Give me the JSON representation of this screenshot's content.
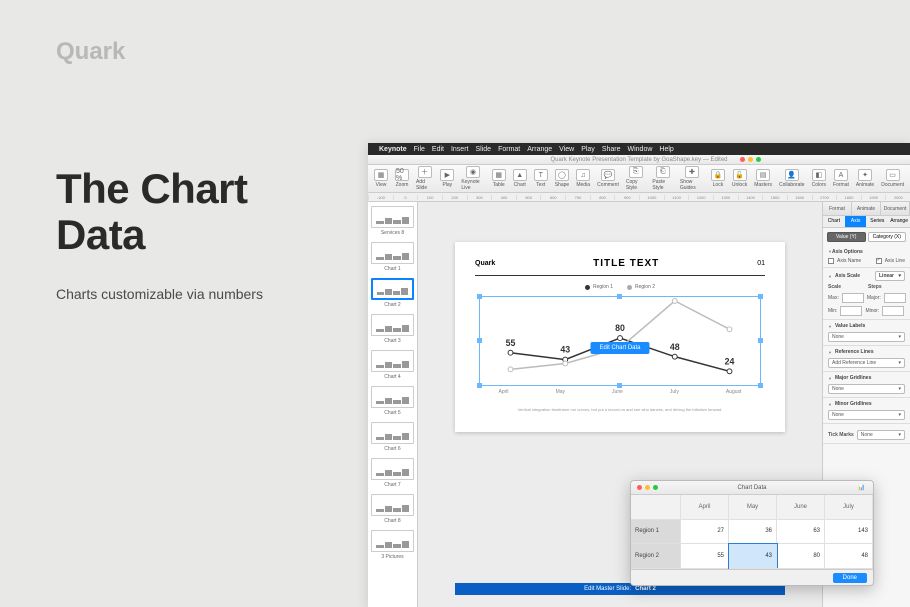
{
  "marketing": {
    "brand": "Quark",
    "headline": "The Chart Data",
    "subtext": "Charts customizable via numbers"
  },
  "menubar": [
    "Keynote",
    "File",
    "Edit",
    "Insert",
    "Slide",
    "Format",
    "Arrange",
    "View",
    "Play",
    "Share",
    "Window",
    "Help"
  ],
  "window_title": "Quark Keynote Presentation Template by GoaShape.key — Edited",
  "toolbar": [
    {
      "label": "View",
      "icon": "▦"
    },
    {
      "label": "Zoom",
      "icon": "50 %"
    },
    {
      "label": "Add Slide",
      "icon": "＋"
    },
    {
      "label": "Play",
      "icon": "▶"
    },
    {
      "label": "Keynote Live",
      "icon": "◉"
    },
    {
      "label": "Table",
      "icon": "▦"
    },
    {
      "label": "Chart",
      "icon": "▲"
    },
    {
      "label": "Text",
      "icon": "T"
    },
    {
      "label": "Shape",
      "icon": "◯"
    },
    {
      "label": "Media",
      "icon": "♫"
    },
    {
      "label": "Comment",
      "icon": "💬"
    },
    {
      "label": "Copy Style",
      "icon": "⎘"
    },
    {
      "label": "Paste Style",
      "icon": "⎗"
    },
    {
      "label": "Show Guides",
      "icon": "✚"
    },
    {
      "label": "Lock",
      "icon": "🔒"
    },
    {
      "label": "Unlock",
      "icon": "🔓"
    },
    {
      "label": "Masters",
      "icon": "▤"
    },
    {
      "label": "Collaborate",
      "icon": "👤"
    },
    {
      "label": "Colors",
      "icon": "◧"
    },
    {
      "label": "Format",
      "icon": "A"
    },
    {
      "label": "Animate",
      "icon": "✦"
    },
    {
      "label": "Document",
      "icon": "▭"
    }
  ],
  "ruler": [
    "-100",
    "0",
    "100",
    "200",
    "300",
    "400",
    "500",
    "600",
    "700",
    "800",
    "900",
    "1000",
    "1100",
    "1200",
    "1300",
    "1400",
    "1500",
    "1600",
    "1700",
    "1800",
    "1900",
    "2000"
  ],
  "thumbs": [
    {
      "label": "Services 8"
    },
    {
      "label": "Chart 1"
    },
    {
      "label": "Chart 2",
      "selected": true
    },
    {
      "label": "Chart 3"
    },
    {
      "label": "Chart 4"
    },
    {
      "label": "Chart 5"
    },
    {
      "label": "Chart 6"
    },
    {
      "label": "Chart 7"
    },
    {
      "label": "Chart 8"
    },
    {
      "label": "3 Pictures"
    }
  ],
  "slide": {
    "brand": "Quark",
    "title": "TITLE TEXT",
    "page": "01",
    "legend": [
      {
        "name": "Region 1",
        "color": "#333"
      },
      {
        "name": "Region 2",
        "color": "#aaa"
      }
    ],
    "edit_button": "Edit Chart Data",
    "caption": "Vertical integration timeframe nor curves, but put a record on and see who dances, and driving the initiative forward."
  },
  "master_bar": {
    "prefix": "Edit Master Slide:",
    "name": "Chart 2"
  },
  "inspector": {
    "top_tabs": [
      "Format",
      "Animate",
      "Document"
    ],
    "sub_tabs": [
      "Chart",
      "Axis",
      "Series",
      "Arrange"
    ],
    "pills": [
      "Value (Y)",
      "Category (X)"
    ],
    "axis_options": {
      "title": "Axis Options",
      "axis_name": "Axis Name",
      "axis_line": "Axis Line"
    },
    "axis_scale": {
      "title": "Axis Scale",
      "value": "Linear",
      "scale": "Scale",
      "steps": "Steps",
      "max": "Max:",
      "min": "Min:",
      "major": "Major:",
      "minor": "Minor:"
    },
    "value_labels": {
      "title": "Value Labels",
      "value": "None"
    },
    "reference_lines": {
      "title": "Reference Lines",
      "value": "Add Reference Line"
    },
    "major_grid": {
      "title": "Major Gridlines",
      "value": "None"
    },
    "minor_grid": {
      "title": "Minor Gridlines",
      "value": "None"
    },
    "tick_marks": {
      "title": "Tick Marks",
      "value": "None"
    }
  },
  "data_popup": {
    "title": "Chart Data",
    "columns": [
      "April",
      "May",
      "June",
      "July"
    ],
    "rows": [
      {
        "name": "Region 1",
        "values": [
          "27",
          "36",
          "63",
          "143"
        ]
      },
      {
        "name": "Region 2",
        "values": [
          "55",
          "43",
          "80",
          "48"
        ]
      }
    ],
    "selected_cell": {
      "row": 1,
      "col": 1
    },
    "done": "Done"
  },
  "chart_data": {
    "type": "line",
    "categories": [
      "April",
      "May",
      "June",
      "July",
      "August"
    ],
    "series": [
      {
        "name": "Region 1",
        "color": "#333333",
        "values": [
          55,
          43,
          80,
          48,
          24
        ]
      },
      {
        "name": "Region 2",
        "color": "#aaaaaa",
        "values": [
          27,
          36,
          63,
          143,
          95
        ]
      }
    ],
    "data_labels_shown": [
      55,
      43,
      80,
      48,
      24
    ],
    "ylim": [
      0,
      150
    ]
  }
}
